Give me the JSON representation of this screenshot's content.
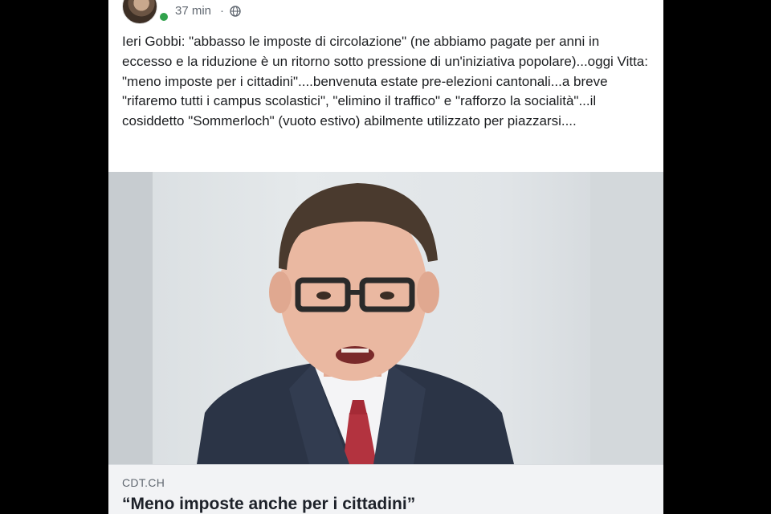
{
  "post": {
    "timestamp": "37 min",
    "separator": "·",
    "privacy_icon": "globe-icon",
    "text": "Ieri Gobbi: \"abbasso le imposte di circolazione\" (ne abbiamo pagate per anni in eccesso e la riduzione è un ritorno sotto pressione di un'iniziativa popolare)...oggi Vitta: \"meno imposte per i cittadini\"....benvenuta estate pre-elezioni cantonali...a breve \"rifaremo tutti i campus scolastici\", \"elimino il traffico\" e \"rafforzo la socialità\"...il cosiddetto \"Sommerloch\" (vuoto estivo) abilmente utilizzato per piazzarsi....",
    "online_color": "#31a24c"
  },
  "link": {
    "domain": "CDT.CH",
    "title": "“Meno imposte anche per i cittadini”"
  }
}
